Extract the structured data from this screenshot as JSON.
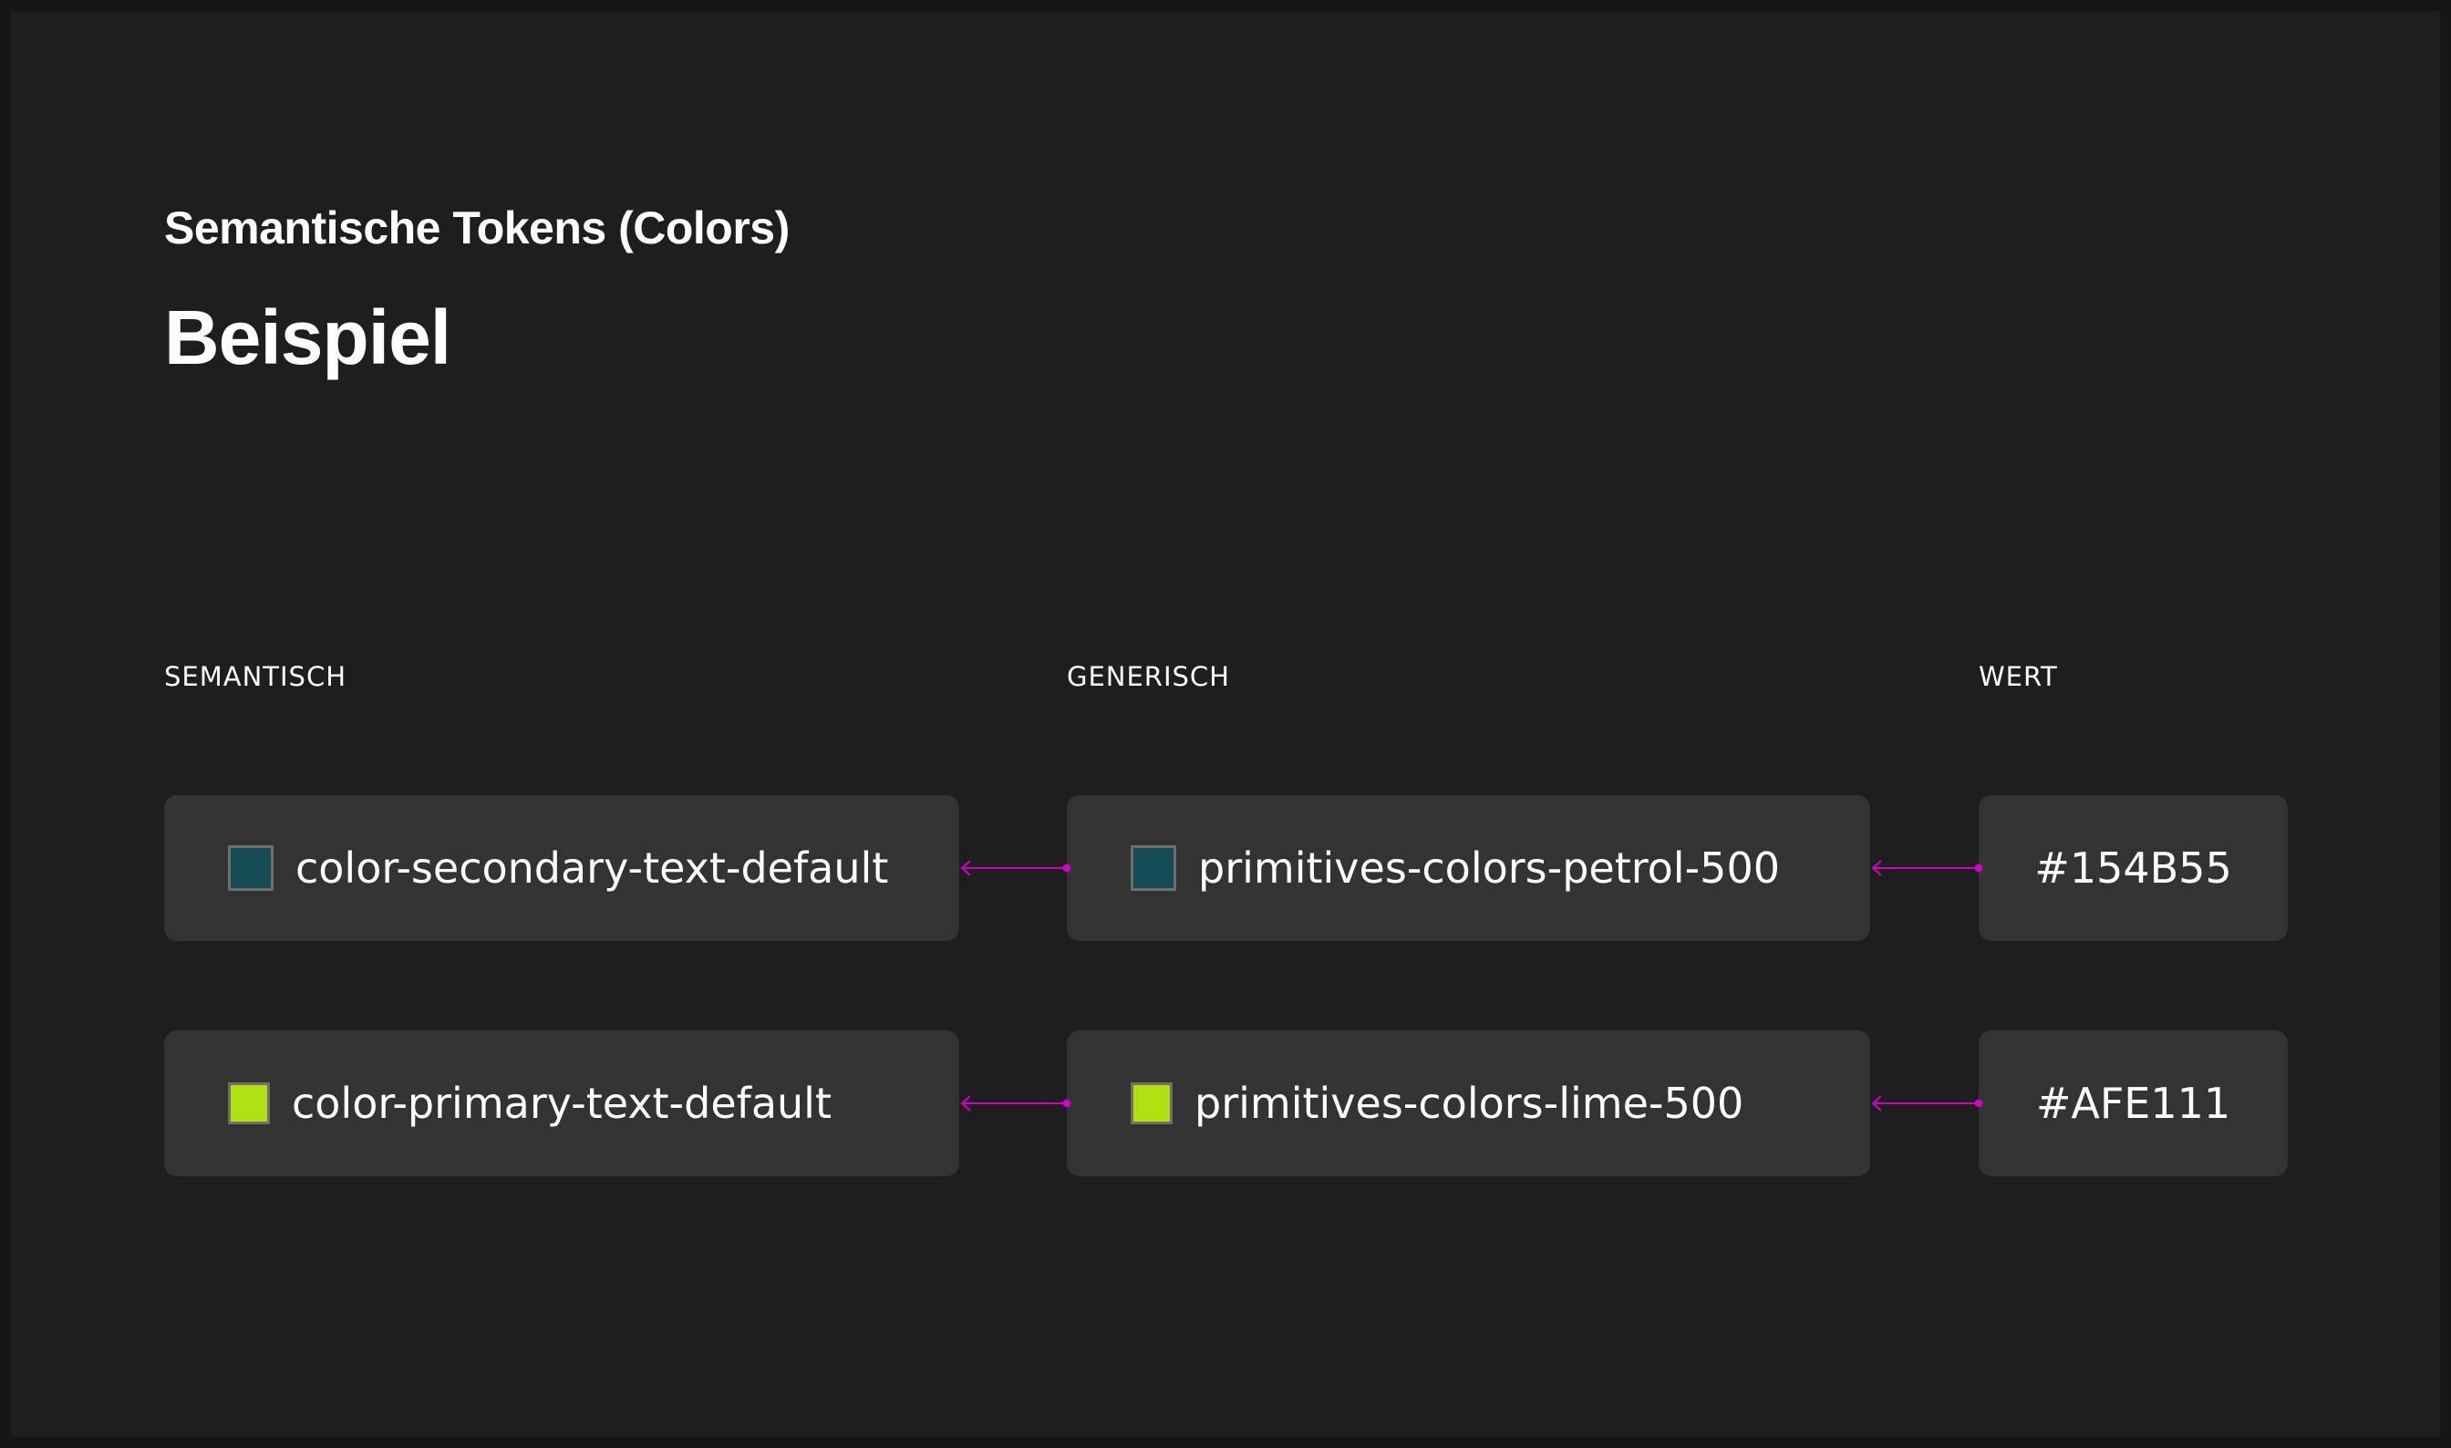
{
  "header": {
    "subtitle": "Semantische Tokens (Colors)",
    "title": "Beispiel"
  },
  "columns": {
    "semantic": "SEMANTISCH",
    "generic": "GENERISCH",
    "value": "WERT"
  },
  "rows": [
    {
      "semantic": "color-secondary-text-default",
      "generic": "primitives-colors-petrol-500",
      "value": "#154B55",
      "swatch_color": "#154B55"
    },
    {
      "semantic": "color-primary-text-default",
      "generic": "primitives-colors-lime-500",
      "value": "#AFE111",
      "swatch_color": "#AFE111"
    }
  ],
  "colors": {
    "background": "#1E1E1E",
    "card": "#333333",
    "connector": "#D100C8"
  }
}
